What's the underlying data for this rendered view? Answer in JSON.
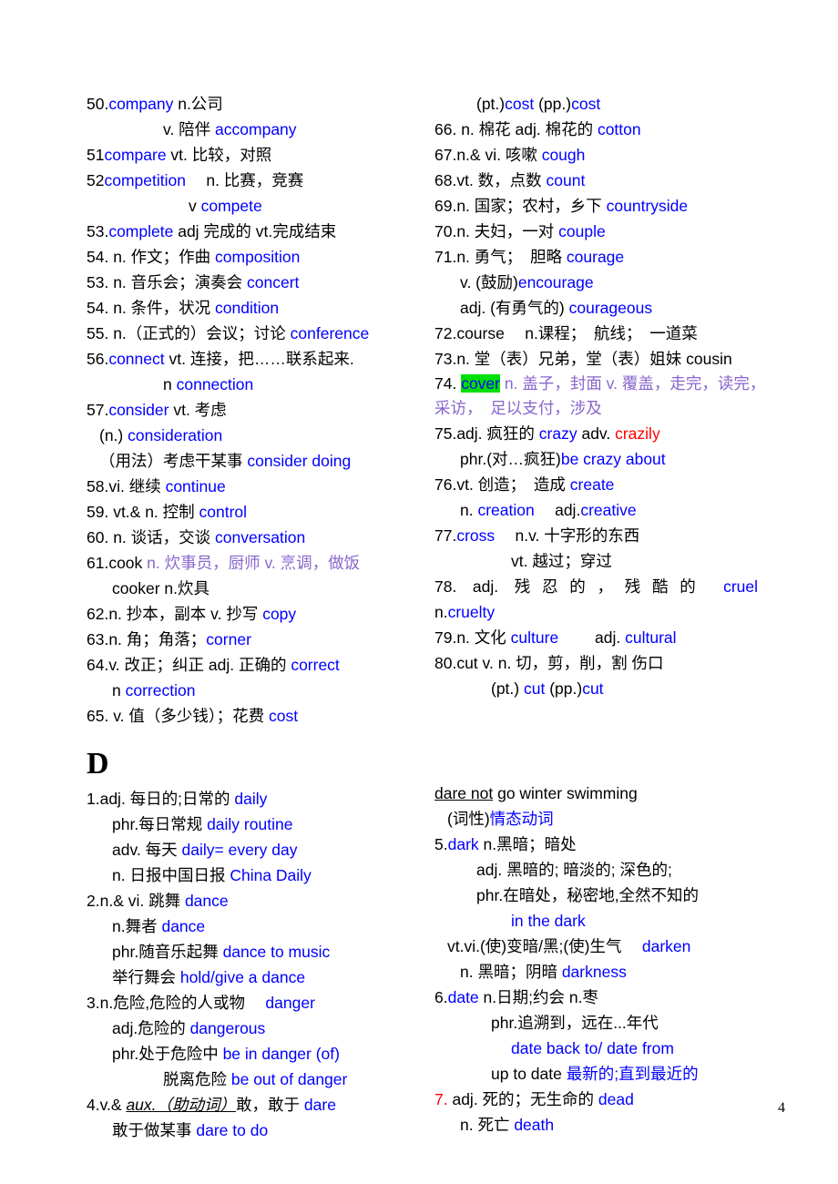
{
  "document": {
    "page_number": "4",
    "section_heading": "D"
  },
  "left_column_top": [
    {
      "parts": [
        {
          "t": "50.",
          "c": "black"
        },
        {
          "t": "company",
          "c": "blue"
        },
        {
          "t": " n.公司",
          "c": "black"
        }
      ],
      "indent": 0
    },
    {
      "parts": [
        {
          "t": "v. 陪伴 ",
          "c": "black"
        },
        {
          "t": "accompany",
          "c": "blue"
        }
      ],
      "indent": 5
    },
    {
      "parts": [
        {
          "t": "51",
          "c": "black"
        },
        {
          "t": "compare",
          "c": "blue"
        },
        {
          "t": " vt. 比较，对照",
          "c": "black"
        }
      ],
      "indent": 0
    },
    {
      "parts": [
        {
          "t": "52",
          "c": "black"
        },
        {
          "t": "competition",
          "c": "blue"
        },
        {
          "t": "　 n. 比赛，竞赛",
          "c": "black"
        }
      ],
      "indent": 0
    },
    {
      "parts": [
        {
          "t": "v ",
          "c": "black"
        },
        {
          "t": "compete",
          "c": "blue"
        }
      ],
      "indent": 6
    },
    {
      "parts": [
        {
          "t": "53.",
          "c": "black"
        },
        {
          "t": "complete",
          "c": "blue"
        },
        {
          "t": " adj 完成的 vt.完成结束",
          "c": "black"
        }
      ],
      "indent": 0
    },
    {
      "parts": [
        {
          "t": "54. n. 作文；作曲 ",
          "c": "black"
        },
        {
          "t": "composition",
          "c": "blue"
        }
      ],
      "indent": 0
    },
    {
      "parts": [
        {
          "t": "53. n. 音乐会；演奏会 ",
          "c": "black"
        },
        {
          "t": "concert",
          "c": "blue"
        }
      ],
      "indent": 0
    },
    {
      "parts": [
        {
          "t": "54. n. 条件，状况 ",
          "c": "black"
        },
        {
          "t": "condition",
          "c": "blue"
        }
      ],
      "indent": 0
    },
    {
      "parts": [
        {
          "t": "55. n.（正式的）会议；讨论 ",
          "c": "black"
        },
        {
          "t": "conference",
          "c": "blue"
        }
      ],
      "indent": 0
    },
    {
      "parts": [
        {
          "t": "56.",
          "c": "black"
        },
        {
          "t": "connect",
          "c": "blue"
        },
        {
          "t": " vt. 连接，把……联系起来.",
          "c": "black"
        }
      ],
      "indent": 0
    },
    {
      "parts": [
        {
          "t": "n ",
          "c": "black"
        },
        {
          "t": "connection",
          "c": "blue"
        }
      ],
      "indent": 5
    },
    {
      "parts": [
        {
          "t": "57.",
          "c": "black"
        },
        {
          "t": "consider",
          "c": "blue"
        },
        {
          "t": " vt. 考虑",
          "c": "black"
        }
      ],
      "indent": 0
    },
    {
      "parts": [
        {
          "t": "(n.) ",
          "c": "black"
        },
        {
          "t": "consideration",
          "c": "blue"
        }
      ],
      "indent": 1
    },
    {
      "parts": [
        {
          "t": "（用法）考虑干某事 ",
          "c": "black"
        },
        {
          "t": "consider doing",
          "c": "blue"
        }
      ],
      "indent": 1
    },
    {
      "parts": [
        {
          "t": "58.vi. 继续 ",
          "c": "black"
        },
        {
          "t": "continue",
          "c": "blue"
        }
      ],
      "indent": 0
    },
    {
      "parts": [
        {
          "t": "59. vt.& n. 控制 ",
          "c": "black"
        },
        {
          "t": "control",
          "c": "blue"
        }
      ],
      "indent": 0
    },
    {
      "parts": [
        {
          "t": "60. n. 谈话，交谈 ",
          "c": "black"
        },
        {
          "t": "conversation",
          "c": "blue"
        }
      ],
      "indent": 0
    },
    {
      "parts": [
        {
          "t": "61.cook  ",
          "c": "black"
        },
        {
          "t": " n. 炊事员，厨师 v. 烹调，做饭",
          "c": "purple"
        }
      ],
      "indent": 0
    },
    {
      "parts": [
        {
          "t": "cooker n.炊具",
          "c": "black"
        }
      ],
      "indent": 2
    },
    {
      "parts": [
        {
          "t": "62.n. 抄本，副本 v. 抄写 ",
          "c": "black"
        },
        {
          "t": "copy",
          "c": "blue"
        }
      ],
      "indent": 0
    },
    {
      "parts": [
        {
          "t": "63.n. 角；角落；",
          "c": "black"
        },
        {
          "t": "corner",
          "c": "blue"
        }
      ],
      "indent": 0
    },
    {
      "parts": [
        {
          "t": "64.v. 改正；纠正 adj. 正确的 ",
          "c": "black"
        },
        {
          "t": "correct",
          "c": "blue"
        }
      ],
      "indent": 0
    },
    {
      "parts": [
        {
          "t": "n ",
          "c": "black"
        },
        {
          "t": "correction",
          "c": "blue"
        }
      ],
      "indent": 2
    },
    {
      "parts": [
        {
          "t": "65. v. 值（多少钱）；花费 ",
          "c": "black"
        },
        {
          "t": "cost",
          "c": "blue"
        }
      ],
      "indent": 0
    }
  ],
  "right_column_top": [
    {
      "parts": [
        {
          "t": "(pt.)",
          "c": "black"
        },
        {
          "t": "cost",
          "c": "blue"
        },
        {
          "t": "    (pp.)",
          "c": "black"
        },
        {
          "t": "cost",
          "c": "blue"
        }
      ],
      "indent": 3
    },
    {
      "parts": [
        {
          "t": "66. n. 棉花 adj. 棉花的 ",
          "c": "black"
        },
        {
          "t": "cotton",
          "c": "blue"
        }
      ],
      "indent": 0
    },
    {
      "parts": [
        {
          "t": "67.n.& vi. 咳嗽 ",
          "c": "black"
        },
        {
          "t": "cough",
          "c": "blue"
        }
      ],
      "indent": 0
    },
    {
      "parts": [
        {
          "t": "68.vt. 数，点数 ",
          "c": "black"
        },
        {
          "t": "count",
          "c": "blue"
        }
      ],
      "indent": 0
    },
    {
      "parts": [
        {
          "t": "69.n. 国家；农村，乡下 ",
          "c": "black"
        },
        {
          "t": "countryside",
          "c": "blue"
        }
      ],
      "indent": 0
    },
    {
      "parts": [
        {
          "t": "70.n. 夫妇，一对 ",
          "c": "black"
        },
        {
          "t": "couple",
          "c": "blue"
        }
      ],
      "indent": 0
    },
    {
      "parts": [
        {
          "t": "71.n. 勇气；　胆略 ",
          "c": "black"
        },
        {
          "t": "courage",
          "c": "blue"
        }
      ],
      "indent": 0
    },
    {
      "parts": [
        {
          "t": "v. (鼓励)",
          "c": "black"
        },
        {
          "t": "encourage",
          "c": "blue"
        }
      ],
      "indent": 2
    },
    {
      "parts": [
        {
          "t": "adj. (有勇气的) ",
          "c": "black"
        },
        {
          "t": "courageous",
          "c": "blue"
        }
      ],
      "indent": 2
    },
    {
      "parts": [
        {
          "t": "72.course　 n.课程；　航线；　一道菜",
          "c": "black"
        }
      ],
      "indent": 0
    },
    {
      "parts": [
        {
          "t": "73.n. 堂（表）兄弟，堂（表）姐妹 cousin",
          "c": "black"
        }
      ],
      "indent": 0
    }
  ],
  "right_74": {
    "number": "74. ",
    "word": "cover",
    "definition": " n. 盖子，封面 v. 覆盖，走完，读完，采访，　足以支付，涉及"
  },
  "right_column_mid": [
    {
      "parts": [
        {
          "t": "75.adj. 疯狂的 ",
          "c": "black"
        },
        {
          "t": "crazy",
          "c": "blue"
        },
        {
          "t": " adv. ",
          "c": "black"
        },
        {
          "t": "crazily",
          "c": "red"
        }
      ],
      "indent": 0
    },
    {
      "parts": [
        {
          "t": "phr.(对…疯狂)",
          "c": "black"
        },
        {
          "t": "be crazy about",
          "c": "blue"
        }
      ],
      "indent": 2
    },
    {
      "parts": [
        {
          "t": "76.vt. 创造；　造成 ",
          "c": "black"
        },
        {
          "t": "create",
          "c": "blue"
        }
      ],
      "indent": 0
    },
    {
      "parts": [
        {
          "t": "n. ",
          "c": "black"
        },
        {
          "t": "creation",
          "c": "blue"
        },
        {
          "t": "　 adj.",
          "c": "black"
        },
        {
          "t": "creative",
          "c": "blue"
        }
      ],
      "indent": 2
    },
    {
      "parts": [
        {
          "t": "77.",
          "c": "black"
        },
        {
          "t": "cross",
          "c": "blue"
        },
        {
          "t": "　 n.v. 十字形的东西",
          "c": "black"
        }
      ],
      "indent": 0
    },
    {
      "parts": [
        {
          "t": "vt. 越过；穿过",
          "c": "black"
        }
      ],
      "indent": 5
    }
  ],
  "right_78": {
    "text": "78. adj. 残忍的，残酷的 ",
    "word": "cruel",
    "next_line_plain": "n.",
    "next_line_word": "cruelty"
  },
  "right_column_bottom": [
    {
      "parts": [
        {
          "t": "79.n. 文化 ",
          "c": "black"
        },
        {
          "t": "culture",
          "c": "blue"
        },
        {
          "t": "　　 adj. ",
          "c": "black"
        },
        {
          "t": "cultural",
          "c": "blue"
        }
      ],
      "indent": 0
    },
    {
      "parts": [
        {
          "t": "80.cut v. n. 切，剪，削，割 伤口",
          "c": "black"
        }
      ],
      "indent": 0
    },
    {
      "parts": [
        {
          "t": "(pt.) ",
          "c": "black"
        },
        {
          "t": "cut",
          "c": "blue"
        },
        {
          "t": " (pp.)",
          "c": "black"
        },
        {
          "t": "cut",
          "c": "blue"
        }
      ],
      "indent": 4
    }
  ],
  "d_left_column": [
    {
      "parts": [
        {
          "t": "1.adj. 每日的;日常的  ",
          "c": "black"
        },
        {
          "t": "daily",
          "c": "blue"
        }
      ],
      "indent": 0
    },
    {
      "parts": [
        {
          "t": "phr.每日常规 ",
          "c": "black"
        },
        {
          "t": "daily routine",
          "c": "blue"
        }
      ],
      "indent": 2
    },
    {
      "parts": [
        {
          "t": "adv. 每天  ",
          "c": "black"
        },
        {
          "t": "daily= every day",
          "c": "blue"
        }
      ],
      "indent": 2
    },
    {
      "parts": [
        {
          "t": "n. 日报中国日报  ",
          "c": "black"
        },
        {
          "t": "China Daily",
          "c": "blue"
        }
      ],
      "indent": 2
    },
    {
      "parts": [
        {
          "t": "2.n.& vi. 跳舞 ",
          "c": "black"
        },
        {
          "t": "dance",
          "c": "blue"
        }
      ],
      "indent": 0
    },
    {
      "parts": [
        {
          "t": "n.舞者 ",
          "c": "black"
        },
        {
          "t": "dance",
          "c": "blue"
        }
      ],
      "indent": 2
    },
    {
      "parts": [
        {
          "t": "phr.随音乐起舞 ",
          "c": "black"
        },
        {
          "t": "dance to music",
          "c": "blue"
        }
      ],
      "indent": 2
    },
    {
      "parts": [
        {
          "t": "举行舞会 ",
          "c": "black"
        },
        {
          "t": "hold/give a dance",
          "c": "blue"
        }
      ],
      "indent": 2
    },
    {
      "parts": [
        {
          "t": "3.n.危险,危险的人或物　 ",
          "c": "black"
        },
        {
          "t": "danger",
          "c": "blue"
        }
      ],
      "indent": 0
    },
    {
      "parts": [
        {
          "t": "adj.危险的 ",
          "c": "black"
        },
        {
          "t": "dangerous",
          "c": "blue"
        }
      ],
      "indent": 2
    },
    {
      "parts": [
        {
          "t": "phr.处于危险中 ",
          "c": "black"
        },
        {
          "t": "be in danger (of)",
          "c": "blue"
        }
      ],
      "indent": 2
    },
    {
      "parts": [
        {
          "t": "脱离危险 ",
          "c": "black"
        },
        {
          "t": "be out of danger",
          "c": "blue"
        }
      ],
      "indent": 5
    }
  ],
  "d_left_item4": {
    "prefix": "4.v.& ",
    "aux_italic": "aux.（助动词）",
    "middle": "敢，敢于 ",
    "word": "dare",
    "sub_plain": "敢于做某事 ",
    "sub_word": "dare to do"
  },
  "d_right_column": [
    {
      "parts": [
        {
          "t": "5.",
          "c": "black"
        },
        {
          "t": "dark",
          "c": "blue"
        },
        {
          "t": " n.黑暗；暗处",
          "c": "black"
        }
      ],
      "indent": 0
    },
    {
      "parts": [
        {
          "t": "adj. 黑暗的; 暗淡的; 深色的;",
          "c": "black"
        }
      ],
      "indent": 3
    },
    {
      "parts": [
        {
          "t": "phr.在暗处，秘密地,全然不知的",
          "c": "black"
        }
      ],
      "indent": 3
    },
    {
      "parts": [
        {
          "t": "in the dark",
          "c": "blue"
        }
      ],
      "indent": 5
    },
    {
      "parts": [
        {
          "t": "vt.vi.(使)变暗/黑;(使)生气　 ",
          "c": "black"
        },
        {
          "t": "darken",
          "c": "blue"
        }
      ],
      "indent": 1
    },
    {
      "parts": [
        {
          "t": "n. 黑暗；阴暗 ",
          "c": "black"
        },
        {
          "t": "darkness",
          "c": "blue"
        }
      ],
      "indent": 2
    },
    {
      "parts": [
        {
          "t": "6.",
          "c": "black"
        },
        {
          "t": "date",
          "c": "blue"
        },
        {
          "t": " n.日期;约会  n.枣",
          "c": "black"
        }
      ],
      "indent": 0
    },
    {
      "parts": [
        {
          "t": "phr.追溯到，远在...年代",
          "c": "black"
        }
      ],
      "indent": 4
    },
    {
      "parts": [
        {
          "t": "date back to/ date from",
          "c": "blue"
        }
      ],
      "indent": 5
    },
    {
      "parts": [
        {
          "t": "up to date ",
          "c": "black"
        },
        {
          "t": "最新的;直到最近的",
          "c": "blue"
        }
      ],
      "indent": 4
    },
    {
      "parts": [
        {
          "t": "7. ",
          "c": "red"
        },
        {
          "t": "adj. 死的；无生命的 ",
          "c": "black"
        },
        {
          "t": "dead",
          "c": "blue"
        }
      ],
      "indent": 0
    },
    {
      "parts": [
        {
          "t": "n. 死亡 ",
          "c": "black"
        },
        {
          "t": "death",
          "c": "blue"
        }
      ],
      "indent": 2
    }
  ],
  "d_right_dare_phrase": {
    "underlined": "  dare not",
    "rest": " go winter swimming",
    "pos_label": "(词性)",
    "pos_value": "情态动词"
  }
}
